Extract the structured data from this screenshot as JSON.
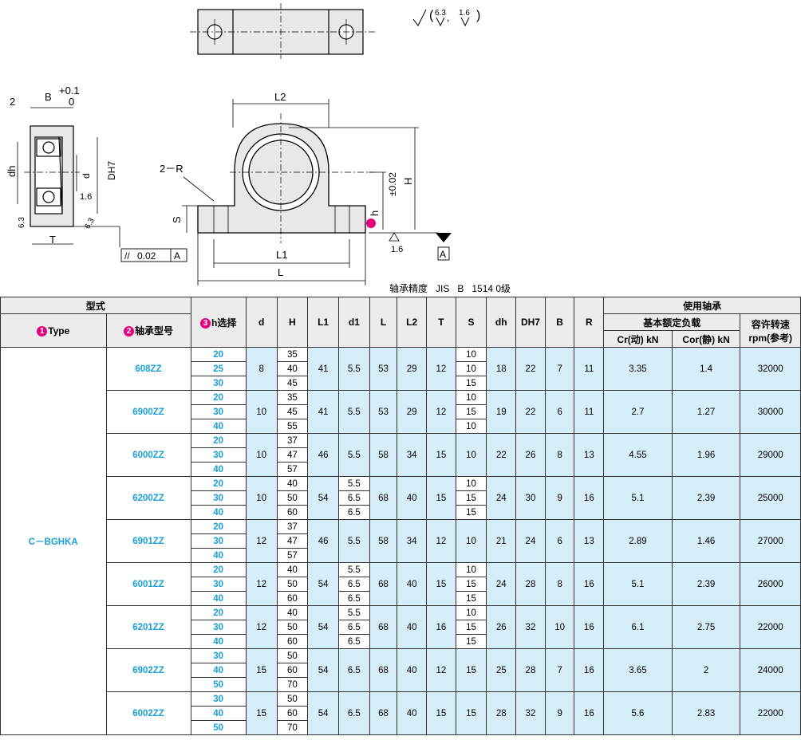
{
  "drawing": {
    "roughness_a": "6.3",
    "roughness_b": "1.6",
    "dim_2": "2",
    "dim_B_tol": "B",
    "dim_B_plus": "+0.1",
    "dim_B_zero": "0",
    "dim_dh": "dh",
    "dim_d": "d",
    "dim_DH7": "DH7",
    "dim_16": "1.6",
    "dim_63_left": "6.3",
    "dim_63_right": "6.3",
    "dim_T": "T",
    "parallel_tol": "0.02",
    "datum_A": "A",
    "dim_L2": "L2",
    "dim_2R": "2－R",
    "dim_S": "S",
    "dim_H": "H",
    "dim_h": "h",
    "dim_h_tol": "±0.02",
    "dim_L1": "L1",
    "dim_L": "L",
    "dim_16_base": "1.6",
    "datum_A2": "A"
  },
  "caption": "轴承精度   JIS   B   1514 0级",
  "header": {
    "model_group": "型式",
    "type_label": "Type",
    "bearing_label": "轴承型号",
    "h_select": "h选择",
    "cols": [
      "d",
      "H",
      "L1",
      "d1",
      "L",
      "L2",
      "T",
      "S",
      "dh",
      "DH7",
      "B",
      "R"
    ],
    "bearing_used": "使用轴承",
    "rated_load": "基本额定负载",
    "cr": "Cr(动) kN",
    "cor": "Cor(静) kN",
    "rpm": "容许转速",
    "rpm_sub": "rpm(参考)"
  },
  "type_value": "C－BGHKA",
  "groups": [
    {
      "model": "608ZZ",
      "h": [
        "20",
        "25",
        "30"
      ],
      "d": "8",
      "H": [
        "35",
        "40",
        "45"
      ],
      "L1": "41",
      "d1": [
        "5.5"
      ],
      "L": "53",
      "L2": "29",
      "T": "12",
      "S": [
        "10",
        "10",
        "15"
      ],
      "dh": "18",
      "DH7": "22",
      "B": "7",
      "R": "11",
      "cr": "3.35",
      "cor": "1.4",
      "rpm": "32000"
    },
    {
      "model": "6900ZZ",
      "h": [
        "20",
        "30",
        "40"
      ],
      "d": "10",
      "H": [
        "35",
        "45",
        "55"
      ],
      "L1": "41",
      "d1": [
        "5.5"
      ],
      "L": "53",
      "L2": "29",
      "T": "12",
      "S": [
        "10",
        "15",
        "10"
      ],
      "dh": "19",
      "DH7": "22",
      "B": "6",
      "R": "11",
      "cr": "2.7",
      "cor": "1.27",
      "rpm": "30000"
    },
    {
      "model": "6000ZZ",
      "h": [
        "20",
        "30",
        "40"
      ],
      "d": "10",
      "H": [
        "37",
        "47",
        "57"
      ],
      "L1": "46",
      "d1": [
        "5.5"
      ],
      "L": "58",
      "L2": "34",
      "T": "15",
      "S": [
        "10"
      ],
      "dh": "22",
      "DH7": "26",
      "B": "8",
      "R": "13",
      "cr": "4.55",
      "cor": "1.96",
      "rpm": "29000"
    },
    {
      "model": "6200ZZ",
      "h": [
        "20",
        "30",
        "40"
      ],
      "d": "10",
      "H": [
        "40",
        "50",
        "60"
      ],
      "L1": "54",
      "d1": [
        "5.5",
        "6.5",
        "6.5"
      ],
      "L": "68",
      "L2": "40",
      "T": "15",
      "S": [
        "10",
        "15",
        "15"
      ],
      "dh": "24",
      "DH7": "30",
      "B": "9",
      "R": "16",
      "cr": "5.1",
      "cor": "2.39",
      "rpm": "25000"
    },
    {
      "model": "6901ZZ",
      "h": [
        "20",
        "30",
        "40"
      ],
      "d": "12",
      "H": [
        "37",
        "47",
        "57"
      ],
      "L1": "46",
      "d1": [
        "5.5"
      ],
      "L": "58",
      "L2": "34",
      "T": "12",
      "S": [
        "10"
      ],
      "dh": "21",
      "DH7": "24",
      "B": "6",
      "R": "13",
      "cr": "2.89",
      "cor": "1.46",
      "rpm": "27000"
    },
    {
      "model": "6001ZZ",
      "h": [
        "20",
        "30",
        "40"
      ],
      "d": "12",
      "H": [
        "40",
        "50",
        "60"
      ],
      "L1": "54",
      "d1": [
        "5.5",
        "6.5",
        "6.5"
      ],
      "L": "68",
      "L2": "40",
      "T": "15",
      "S": [
        "10",
        "15",
        "15"
      ],
      "dh": "24",
      "DH7": "28",
      "B": "8",
      "R": "16",
      "cr": "5.1",
      "cor": "2.39",
      "rpm": "26000"
    },
    {
      "model": "6201ZZ",
      "h": [
        "20",
        "30",
        "40"
      ],
      "d": "12",
      "H": [
        "40",
        "50",
        "60"
      ],
      "L1": "54",
      "d1": [
        "5.5",
        "6.5",
        "6.5"
      ],
      "L": "68",
      "L2": "40",
      "T": "16",
      "S": [
        "10",
        "15",
        "15"
      ],
      "dh": "26",
      "DH7": "32",
      "B": "10",
      "R": "16",
      "cr": "6.1",
      "cor": "2.75",
      "rpm": "22000"
    },
    {
      "model": "6902ZZ",
      "h": [
        "30",
        "40",
        "50"
      ],
      "d": "15",
      "H": [
        "50",
        "60",
        "70"
      ],
      "L1": "54",
      "d1": [
        "6.5"
      ],
      "L": "68",
      "L2": "40",
      "T": "12",
      "S": [
        "15"
      ],
      "dh": "25",
      "DH7": "28",
      "B": "7",
      "R": "16",
      "cr": "3.65",
      "cor": "2",
      "rpm": "24000"
    },
    {
      "model": "6002ZZ",
      "h": [
        "30",
        "40",
        "50"
      ],
      "d": "15",
      "H": [
        "50",
        "60",
        "70"
      ],
      "L1": "54",
      "d1": [
        "6.5"
      ],
      "L": "68",
      "L2": "40",
      "T": "15",
      "S": [
        "15"
      ],
      "dh": "28",
      "DH7": "32",
      "B": "9",
      "R": "16",
      "cr": "5.6",
      "cor": "2.83",
      "rpm": "22000"
    }
  ]
}
